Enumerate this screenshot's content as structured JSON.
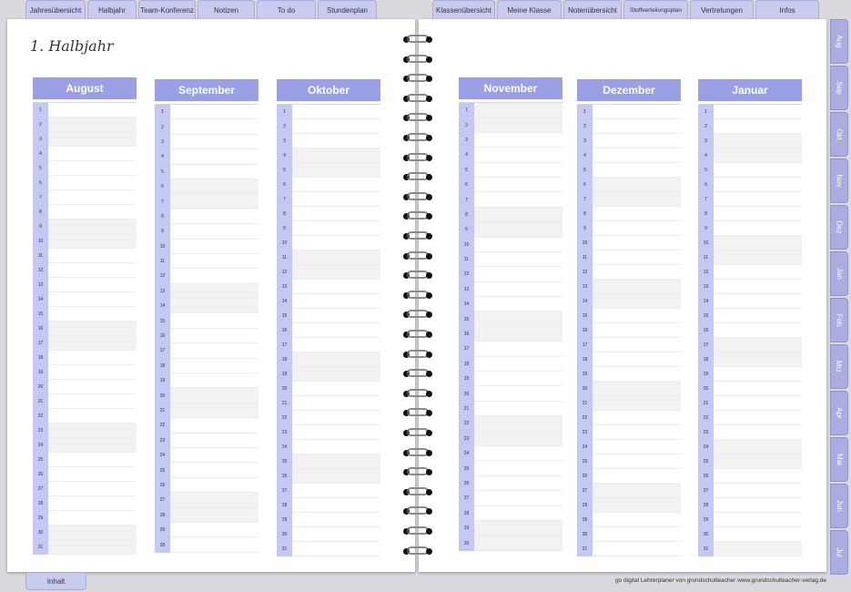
{
  "top_tabs_left": [
    {
      "label": "Jahresübersicht"
    },
    {
      "label": "Halbjahr"
    },
    {
      "label": "Team-Konferenz"
    },
    {
      "label": "Notizen"
    },
    {
      "label": "To do"
    },
    {
      "label": "Stundenplan"
    }
  ],
  "top_tabs_right": [
    {
      "label": "Klassenübersicht"
    },
    {
      "label": "Meine Klasse"
    },
    {
      "label": "Notenübersicht"
    },
    {
      "label": "Stoffverteilungsplan"
    },
    {
      "label": "Vertretungen"
    },
    {
      "label": "Infos"
    }
  ],
  "page_title": "1. Halbjahr",
  "months": [
    {
      "name": "August",
      "days": 31,
      "weekend_days": [
        2,
        3,
        9,
        10,
        16,
        17,
        23,
        24,
        30,
        31
      ]
    },
    {
      "name": "September",
      "days": 30,
      "weekend_days": [
        6,
        7,
        13,
        14,
        20,
        21,
        27,
        28
      ]
    },
    {
      "name": "Oktober",
      "days": 31,
      "weekend_days": [
        4,
        5,
        11,
        12,
        18,
        19,
        25,
        26
      ]
    },
    {
      "name": "November",
      "days": 30,
      "weekend_days": [
        1,
        2,
        8,
        9,
        15,
        16,
        22,
        23,
        29,
        30
      ]
    },
    {
      "name": "Dezember",
      "days": 31,
      "weekend_days": [
        6,
        7,
        13,
        14,
        20,
        21,
        27,
        28
      ]
    },
    {
      "name": "Januar",
      "days": 31,
      "weekend_days": [
        3,
        4,
        10,
        11,
        17,
        18,
        24,
        25,
        31
      ]
    }
  ],
  "side_tabs": [
    {
      "label": "Aug"
    },
    {
      "label": "Sep"
    },
    {
      "label": "Okt"
    },
    {
      "label": "Nov"
    },
    {
      "label": "Dez"
    },
    {
      "label": "Jan"
    },
    {
      "label": "Feb"
    },
    {
      "label": "Mrz"
    },
    {
      "label": "Apr"
    },
    {
      "label": "Mai"
    },
    {
      "label": "Jun"
    },
    {
      "label": "Jul"
    }
  ],
  "bottom_tab": {
    "label": "Inhalt"
  },
  "footer": "go digital Lehrerplaner von grundschulteacher www.grundschulteacher-verlag.de",
  "colors": {
    "accent": "#9aa0e3",
    "day_column": "#c5c8f2",
    "tab": "#c9cbef"
  }
}
